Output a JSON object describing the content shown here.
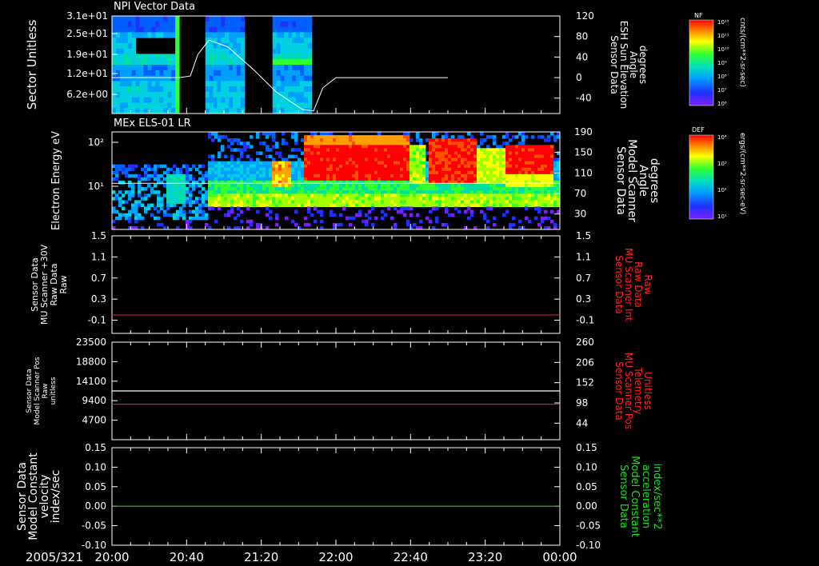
{
  "chart_data": [
    {
      "type": "heatmap",
      "title": "NPI Vector Data",
      "ylabel": "Sector Unitless",
      "y_ticks": [
        "3.1e+01",
        "2.5e+01",
        "1.9e+01",
        "1.2e+01",
        "6.2e+00"
      ],
      "right_ylabel": [
        "Sensor Data",
        "ESH Sun Elevation",
        "Angle",
        "degrees"
      ],
      "right_ticks": [
        120,
        80,
        40,
        0,
        -40
      ],
      "right_ylim": [
        -70,
        120
      ],
      "colorbar": {
        "label": "NF",
        "units": "cnts/(cm**2-sr-sec)",
        "ticks": [
          "10¹²",
          "10¹¹",
          "10¹⁰",
          "10⁹",
          "10⁸",
          "10⁷",
          "10⁶"
        ]
      },
      "data_intervals_min": [
        [
          0,
          36
        ],
        [
          50,
          71
        ],
        [
          86,
          107
        ]
      ],
      "sun_elevation_series": {
        "x_min": [
          0,
          36,
          42,
          46,
          52,
          62,
          76,
          88,
          102,
          108,
          113,
          120,
          180
        ],
        "y": [
          0,
          0,
          3,
          45,
          73,
          60,
          15,
          -28,
          -62,
          -65,
          -20,
          0,
          0
        ]
      }
    },
    {
      "type": "heatmap",
      "title": "MEx ELS-01 LR",
      "ylabel": "Electron Energy eV",
      "y_ticks": [
        "10²",
        "10¹"
      ],
      "right_ylabel": [
        "Sensor Data",
        "Model Scanner",
        "Angle",
        "degrees"
      ],
      "right_ticks": [
        190,
        150,
        110,
        70,
        30
      ],
      "right_ylim": [
        0,
        190
      ],
      "colorbar": {
        "label": "DEF",
        "units": "ergs/(cm**2-sr-sec-eV)",
        "ticks": [
          "10⁴",
          "10³",
          "10²",
          "10¹"
        ]
      },
      "scanner_angle_value": 90
    },
    {
      "type": "line",
      "ylabel": [
        "Sensor Data",
        "MU Scanner +30V",
        "Raw Data",
        "Raw"
      ],
      "y_ticks": [
        1.5,
        1.1,
        0.7,
        0.3,
        -0.1
      ],
      "right_ylabel": [
        "Sensor Data",
        "MU Scanner Int",
        "Raw Data",
        "Raw"
      ],
      "right_ticks": [
        1.5,
        1.1,
        0.7,
        0.3,
        -0.1
      ],
      "ylim": [
        -0.35,
        1.5
      ],
      "series": [
        {
          "color": "#d22020",
          "y_left": 0.0
        }
      ]
    },
    {
      "type": "line",
      "ylabel": [
        "Sensor Data",
        "Model Scanner Pos",
        "Raw",
        "unitless"
      ],
      "y_ticks": [
        23500,
        18800,
        14100,
        9400,
        4700
      ],
      "right_ylabel": [
        "Sensor Data",
        "MU Scanner Pos",
        "Telemetry",
        "Unitless"
      ],
      "right_ticks": [
        260,
        206,
        152,
        98,
        44
      ],
      "ylim": [
        0,
        23500
      ],
      "right_ylim": [
        0,
        260
      ],
      "series": [
        {
          "color": "#ffffff",
          "y_left": 11750
        },
        {
          "color": "#d22020",
          "y_left": 8550
        }
      ]
    },
    {
      "type": "line",
      "ylabel": [
        "Sensor Data",
        "Model Constant",
        "velocity",
        "index/sec"
      ],
      "y_ticks": [
        "0.15",
        "0.10",
        "0.05",
        "0.00",
        "-0.05",
        "-0.10"
      ],
      "right_ylabel": [
        "Sensor Data",
        "Model Constant",
        "acceleration",
        "index/sec**2"
      ],
      "right_ticks": [
        "0.15",
        "0.10",
        "0.05",
        "0.00",
        "-0.05",
        "-0.10"
      ],
      "ylim": [
        -0.1,
        0.15
      ],
      "series": [
        {
          "color": "#22cc22",
          "y_left": 0.0
        }
      ]
    }
  ],
  "x_axis": {
    "date_label": "2005/321",
    "ticks": [
      "20:00",
      "20:40",
      "21:20",
      "22:00",
      "22:40",
      "23:20",
      "00:00"
    ],
    "range_min": [
      0,
      240
    ]
  },
  "colors": {
    "background": "#000000",
    "axis": "#ffffff",
    "right_label_red": "#ff2020",
    "right_label_green": "#22dd22"
  }
}
